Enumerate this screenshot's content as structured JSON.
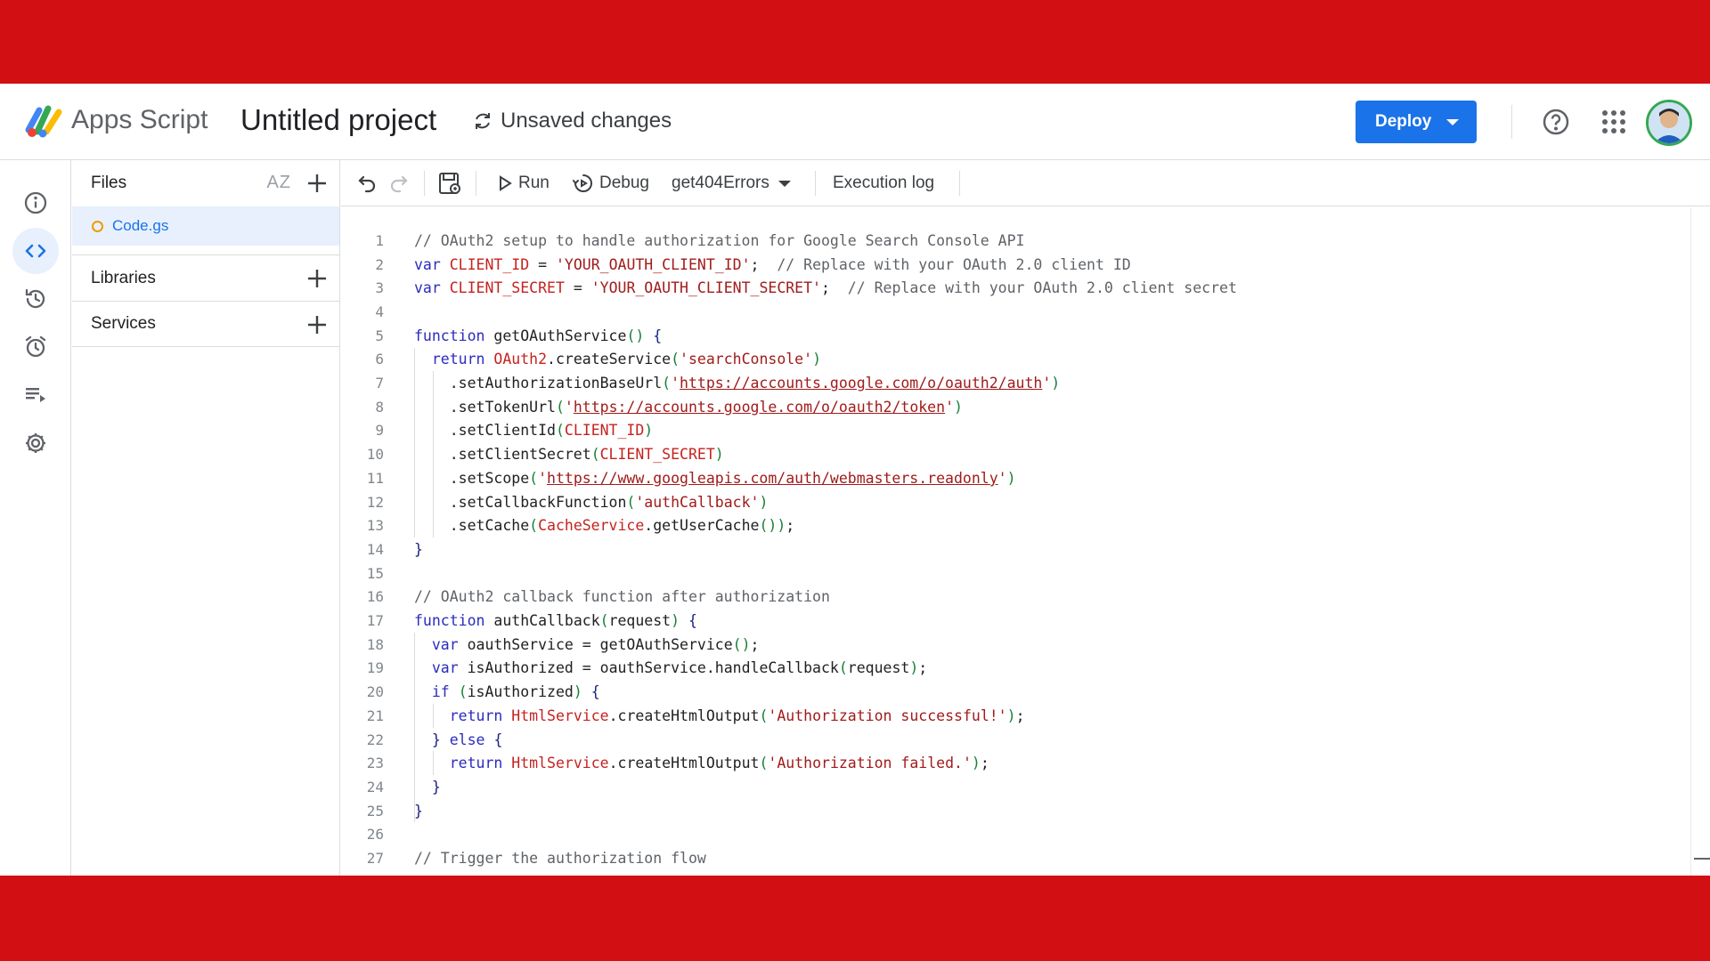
{
  "header": {
    "app_name": "Apps Script",
    "project_title": "Untitled project",
    "save_status": "Unsaved changes",
    "deploy_label": "Deploy"
  },
  "rail": {
    "items": [
      "overview-icon",
      "editor-icon",
      "executions-icon",
      "triggers-icon",
      "executions-list-icon",
      "settings-icon"
    ],
    "active": "editor-icon"
  },
  "files": {
    "title": "Files",
    "sort_label": "AZ",
    "file_list": [
      "Code.gs"
    ],
    "libraries_label": "Libraries",
    "services_label": "Services"
  },
  "toolbar": {
    "run_label": "Run",
    "debug_label": "Debug",
    "function_name": "get404Errors",
    "execution_log_label": "Execution log"
  },
  "editor": {
    "lines": [
      "// OAuth2 setup to handle authorization for Google Search Console API",
      "var CLIENT_ID = 'YOUR_OAUTH_CLIENT_ID';  // Replace with your OAuth 2.0 client ID",
      "var CLIENT_SECRET = 'YOUR_OAUTH_CLIENT_SECRET';  // Replace with your OAuth 2.0 client secret",
      "",
      "function getOAuthService() {",
      "  return OAuth2.createService('searchConsole')",
      "    .setAuthorizationBaseUrl('https://accounts.google.com/o/oauth2/auth')",
      "    .setTokenUrl('https://accounts.google.com/o/oauth2/token')",
      "    .setClientId(CLIENT_ID)",
      "    .setClientSecret(CLIENT_SECRET)",
      "    .setScope('https://www.googleapis.com/auth/webmasters.readonly')",
      "    .setCallbackFunction('authCallback')",
      "    .setCache(CacheService.getUserCache());",
      "}",
      "",
      "// OAuth2 callback function after authorization",
      "function authCallback(request) {",
      "  var oauthService = getOAuthService();",
      "  var isAuthorized = oauthService.handleCallback(request);",
      "  if (isAuthorized) {",
      "    return HtmlService.createHtmlOutput('Authorization successful!');",
      "  } else {",
      "    return HtmlService.createHtmlOutput('Authorization failed.');",
      "  }",
      "}",
      "",
      "// Trigger the authorization flow"
    ]
  },
  "colors": {
    "banner": "#d20f12",
    "accent": "#1a73e8",
    "keyword": "#2b2bbf",
    "string": "#a11b1b",
    "comment": "#5f6368"
  }
}
